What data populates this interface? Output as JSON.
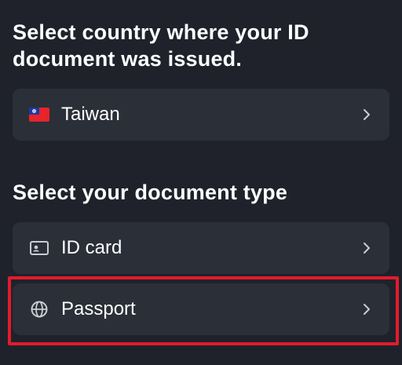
{
  "country_section": {
    "heading": "Select country where your ID document was issued.",
    "selected_country": {
      "label": "Taiwan",
      "icon": "taiwan-flag-icon"
    }
  },
  "document_section": {
    "heading": "Select your document type",
    "options": [
      {
        "label": "ID card",
        "icon": "id-card-icon"
      },
      {
        "label": "Passport",
        "icon": "globe-icon"
      }
    ]
  },
  "colors": {
    "background": "#1f222b",
    "row_background": "#2b2f38",
    "highlight": "#e21b2b",
    "text": "#ffffff",
    "icon": "#c9ccd3"
  }
}
